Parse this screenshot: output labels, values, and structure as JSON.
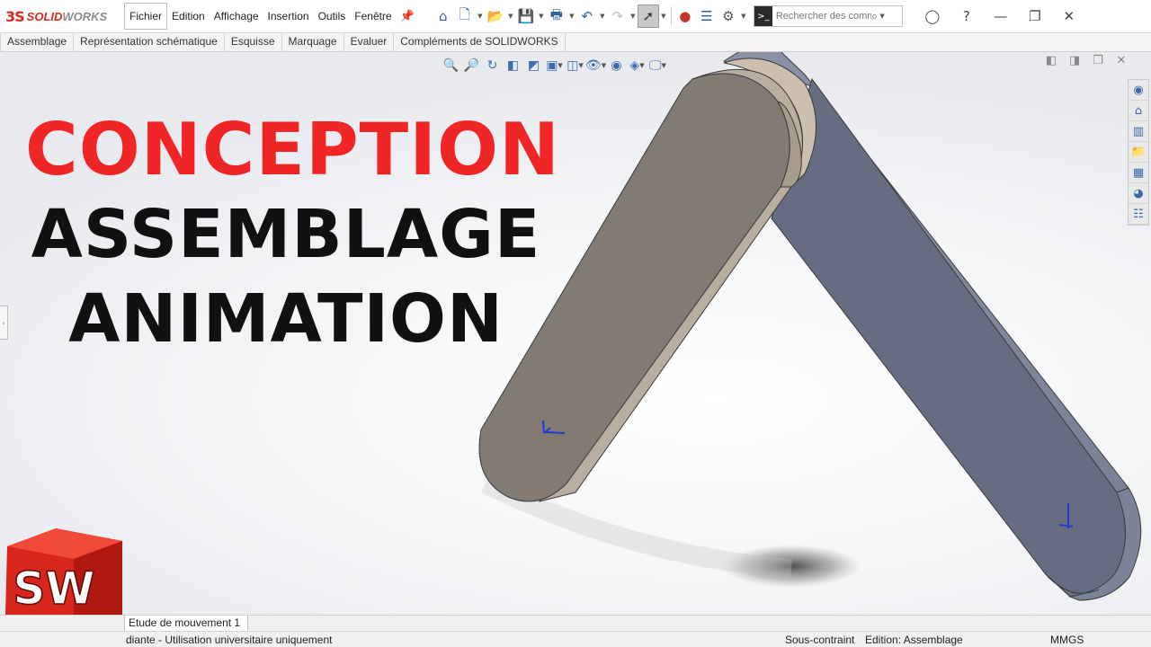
{
  "app": {
    "logo_mark": "3S",
    "name_a": "SOLID",
    "name_b": "WORKS"
  },
  "menu": [
    "Fichier",
    "Edition",
    "Affichage",
    "Insertion",
    "Outils",
    "Fenêtre"
  ],
  "search": {
    "placeholder": "Rechercher des comm"
  },
  "tabs": [
    "Assemblage",
    "Représentation schématique",
    "Esquisse",
    "Marquage",
    "Evaluer",
    "Compléments de SOLIDWORKS"
  ],
  "headline": {
    "line1": "CONCEPTION",
    "line2": "ASSEMBLAGE",
    "line3": "ANIMATION"
  },
  "badge": {
    "letters": "SW"
  },
  "motion_tab": {
    "label": "Etude de mouvement 1"
  },
  "status": {
    "license": "diante - Utilisation universitaire uniquement",
    "constraint": "Sous-contraint",
    "mode": "Edition: Assemblage",
    "units": "MMGS"
  },
  "colors": {
    "headline_accent": "#f02626",
    "brand_red": "#d52b1e",
    "link_front": "#827b73",
    "link_back": "#666d82"
  }
}
